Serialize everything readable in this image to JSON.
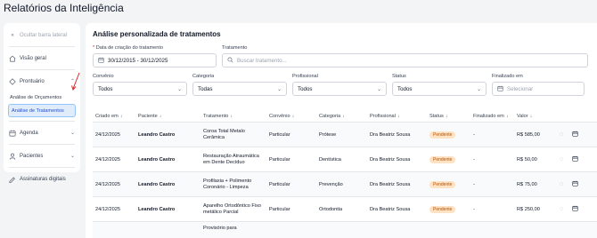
{
  "page": {
    "title": "Relatórios da Inteligência"
  },
  "sidebar": {
    "hide_label": "Ocultar barra lateral",
    "items": [
      {
        "label": "Visão geral",
        "icon": "home-icon"
      },
      {
        "label": "Prontuário",
        "icon": "target-icon",
        "expanded": true,
        "children": [
          {
            "label": "Análise de Orçamentos",
            "active": false
          },
          {
            "label": "Análise de Tratamentos",
            "active": true
          }
        ]
      },
      {
        "label": "Agenda",
        "icon": "calendar-icon"
      },
      {
        "label": "Pacientes",
        "icon": "user-icon"
      },
      {
        "label": "Assinaturas digitais",
        "icon": "signature-icon"
      }
    ]
  },
  "main": {
    "title": "Análise personalizada de tratamentos",
    "filters": {
      "date_label": "Data de criação do tratamento",
      "date_value": "30/12/2015 - 30/12/2025",
      "treatment_label": "Tratamento",
      "treatment_placeholder": "Buscar tratamento...",
      "convenio_label": "Convênio",
      "convenio_value": "Todos",
      "categoria_label": "Categoria",
      "categoria_value": "Todas",
      "profissional_label": "Profissional",
      "profissional_value": "Todos",
      "status_label": "Status",
      "status_value": "Todos",
      "finalizado_label": "Finalizado em",
      "finalizado_placeholder": "Selecionar"
    },
    "table": {
      "headers": [
        "Criado em",
        "Paciente",
        "Tratamento",
        "Convênio",
        "Categoria",
        "Profissional",
        "Status",
        "Finalizado em",
        "Valor"
      ],
      "rows": [
        {
          "criado": "24/12/2025",
          "paciente": "Leandro Castro",
          "tratamento": "Coroa Total Metalo Cerâmica",
          "convenio": "Particular",
          "categoria": "Prótese",
          "profissional": "Dra Beatriz Sousa",
          "status": "Pendente",
          "finalizado": "-",
          "valor": "R$ 585,00"
        },
        {
          "criado": "24/12/2025",
          "paciente": "Leandro Castro",
          "tratamento": "Restauração Atraumática em Dente Decíduo",
          "convenio": "Particular",
          "categoria": "Dentística",
          "profissional": "Dra Beatriz Sousa",
          "status": "Pendente",
          "finalizado": "-",
          "valor": "R$ 50,00"
        },
        {
          "criado": "24/12/2025",
          "paciente": "Leandro Castro",
          "tratamento": "Profilaxia + Polimento Coronário - Limpeza",
          "convenio": "Particular",
          "categoria": "Prevenção",
          "profissional": "Dra Beatriz Sousa",
          "status": "Pendente",
          "finalizado": "-",
          "valor": "R$ 75,00"
        },
        {
          "criado": "24/12/2025",
          "paciente": "Leandro Castro",
          "tratamento": "Aparelho Ortodôntico Fixo metálico Parcial",
          "convenio": "Particular",
          "categoria": "Ortodontia",
          "profissional": "Dra Beatriz Sousa",
          "status": "Pendente",
          "finalizado": "-",
          "valor": "R$ 250,00"
        },
        {
          "criado": "",
          "paciente": "",
          "tratamento": "Provisório para",
          "convenio": "",
          "categoria": "",
          "profissional": "",
          "status": "",
          "finalizado": "",
          "valor": ""
        }
      ]
    }
  }
}
